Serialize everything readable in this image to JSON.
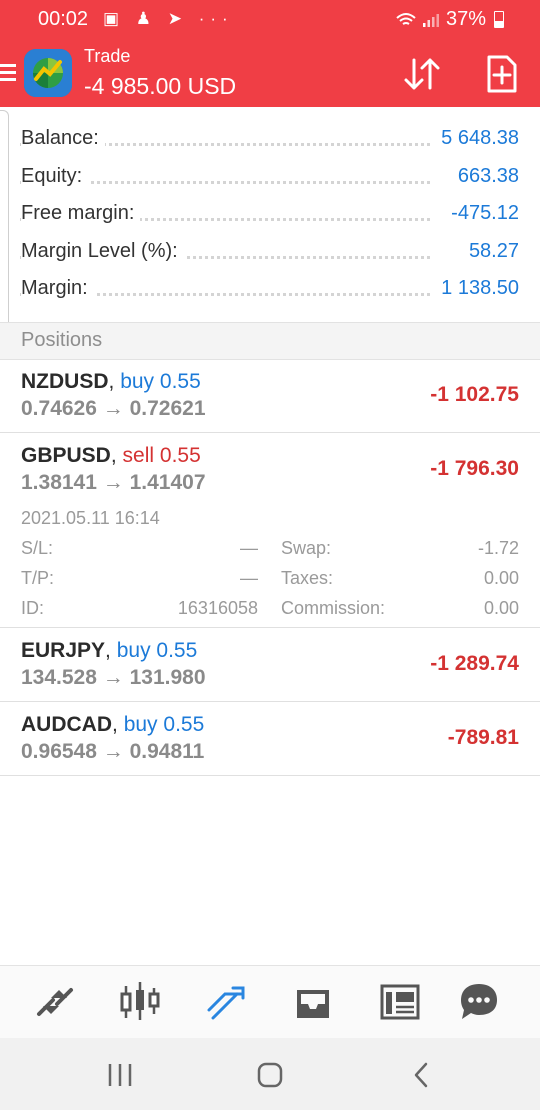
{
  "status_bar": {
    "time": "00:02",
    "battery": "37%"
  },
  "app_bar": {
    "title": "Trade",
    "subtitle": "-4 985.00 USD"
  },
  "summary": [
    {
      "label": "Balance:",
      "value": "5 648.38"
    },
    {
      "label": "Equity:",
      "value": "663.38"
    },
    {
      "label": "Free margin:",
      "value": "-475.12"
    },
    {
      "label": "Margin Level (%):",
      "value": "58.27"
    },
    {
      "label": "Margin:",
      "value": "1 138.50"
    }
  ],
  "positions_header": "Positions",
  "positions": [
    {
      "symbol": "NZDUSD",
      "type": "buy",
      "volume": "0.55",
      "open": "0.74626",
      "current": "0.72621",
      "profit": "-1 102.75"
    },
    {
      "symbol": "GBPUSD",
      "type": "sell",
      "volume": "0.55",
      "open": "1.38141",
      "current": "1.41407",
      "profit": "-1 796.30",
      "details": {
        "time": "2021.05.11 16:14",
        "sl_label": "S/L:",
        "sl": "—",
        "tp_label": "T/P:",
        "tp": "—",
        "id_label": "ID:",
        "id": "16316058",
        "swap_label": "Swap:",
        "swap": "-1.72",
        "taxes_label": "Taxes:",
        "taxes": "0.00",
        "commission_label": "Commission:",
        "commission": "0.00"
      }
    },
    {
      "symbol": "EURJPY",
      "type": "buy",
      "volume": "0.55",
      "open": "134.528",
      "current": "131.980",
      "profit": "-1 289.74"
    },
    {
      "symbol": "AUDCAD",
      "type": "buy",
      "volume": "0.55",
      "open": "0.96548",
      "current": "0.94811",
      "profit": "-789.81"
    }
  ],
  "arrow": "→",
  "comma": ",",
  "colors": {
    "header_red": "#f03e45",
    "value_blue": "#1c7ad8",
    "loss_red": "#d43232",
    "active_tab": "#2a86e0"
  },
  "tabs": [
    "quotes-icon",
    "chart-icon",
    "trade-icon",
    "history-icon",
    "news-icon",
    "messages-icon"
  ]
}
